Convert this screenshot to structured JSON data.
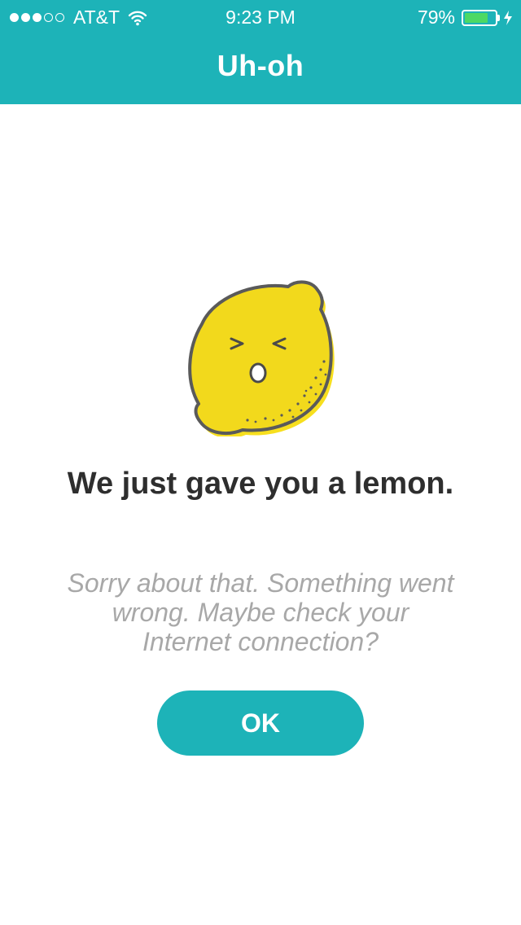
{
  "status_bar": {
    "carrier": "AT&T",
    "time": "9:23 PM",
    "battery_percent": "79%",
    "battery_level": 0.79,
    "signal_bars_filled": 3,
    "signal_bars_total": 5
  },
  "nav": {
    "title": "Uh-oh"
  },
  "error": {
    "icon": "lemon-icon",
    "headline": "We just gave you a lemon.",
    "message": "Sorry about that. Something went wrong. Maybe check your Internet connection?",
    "ok_label": "OK"
  },
  "colors": {
    "accent": "#1db3b8",
    "lemon": "#f7df1e",
    "headline": "#2e2e2e",
    "message": "#a8a8a8",
    "battery": "#4cd964"
  }
}
